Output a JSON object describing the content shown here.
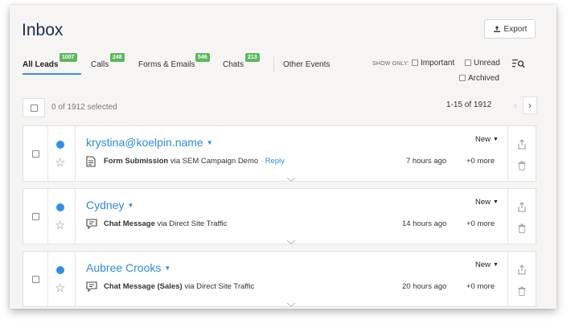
{
  "header": {
    "title": "Inbox",
    "export_label": "Export"
  },
  "tabs": [
    {
      "label": "All Leads",
      "count": "1007",
      "active": true
    },
    {
      "label": "Calls",
      "count": "248"
    },
    {
      "label": "Forms & Emails",
      "count": "546"
    },
    {
      "label": "Chats",
      "count": "213"
    },
    {
      "label": "Other Events"
    }
  ],
  "filters": {
    "show_only_label": "SHOW ONLY:",
    "important": "Important",
    "unread": "Unread",
    "archived": "Archived"
  },
  "selection": {
    "text": "0 of 1912 selected"
  },
  "pagination": {
    "range": "1-15 of 1912"
  },
  "leads": [
    {
      "name": "krystina@koelpin.name",
      "source_type": "Form Submission",
      "via": "via SEM Campaign Demo",
      "reply": "Reply",
      "status": "New",
      "time": "7 hours ago",
      "more": "+0 more",
      "icon": "form-document-icon",
      "unread": true
    },
    {
      "name": "Cydney",
      "source_type": "Chat Message",
      "via": "via Direct Site Traffic",
      "status": "New",
      "time": "14 hours ago",
      "more": "+0 more",
      "icon": "chat-bubble-icon",
      "unread": true
    },
    {
      "name": "Aubree Crooks",
      "source_type": "Chat Message (Sales)",
      "via": "via Direct Site Traffic",
      "status": "New",
      "time": "20 hours ago",
      "more": "+0 more",
      "icon": "chat-bubble-icon",
      "unread": true
    }
  ],
  "colors": {
    "accent": "#2f8fe6",
    "badge": "#5cb85c",
    "title": "#1d2b4f"
  }
}
